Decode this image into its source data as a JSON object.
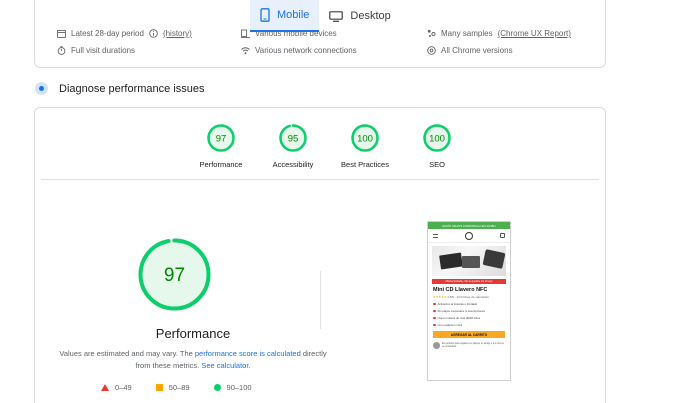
{
  "device_tabs": {
    "mobile": "Mobile",
    "desktop": "Desktop"
  },
  "field_info": {
    "latest_period": "Latest 28-day period",
    "history_link": "(history)",
    "mobile_devices": "Various mobile devices",
    "samples": "Many samples",
    "crux_link": "(Chrome UX Report)",
    "visit_durations": "Full visit durations",
    "network": "Various network connections",
    "chrome_versions": "All Chrome versions"
  },
  "diagnose": {
    "title": "Diagnose performance issues"
  },
  "scores": [
    {
      "label": "Performance",
      "value": 97
    },
    {
      "label": "Accessibility",
      "value": 95
    },
    {
      "label": "Best Practices",
      "value": 100
    },
    {
      "label": "SEO",
      "value": 100
    }
  ],
  "main_score": {
    "value": "97",
    "numeric": 97,
    "title": "Performance"
  },
  "note": {
    "text1": "Values are estimated and may vary. The ",
    "link1": "performance score is calculated",
    "text2": " directly from these metrics. ",
    "link2": "See calculator."
  },
  "legend": {
    "fail": "0–49",
    "average": "50–89",
    "pass": "90–100"
  },
  "colors": {
    "pass": "#0cce6b",
    "pass_text": "#008800",
    "pass_bg": "#e6f7ec",
    "average": "#ffa400",
    "fail": "#e53935",
    "accent": "#1a73e8"
  },
  "phone_preview": {
    "banner": "ENVÍO GRATIS A PENINSULA EN 24/48H",
    "red_bar": "Oferta limitada - No te quedes sin el tuyo",
    "title": "Mini CD Llavero NFC",
    "stars": "★★★★★",
    "rating_text": "4.8/5 - 124 fichas de valoración",
    "bullet1": "Activación al instante e ilimitado",
    "bullet2": "Sin pagos mensuales ni suscripciones",
    "bullet3": "Usa tu música de más 200M sitios",
    "bullet4": "Con cualquier móvil",
    "button": "AGREGAR AL CARRITO",
    "review": "Es perfecto para regalar a tu pareja, tu amigo o a ti mismo. Le encantará."
  }
}
